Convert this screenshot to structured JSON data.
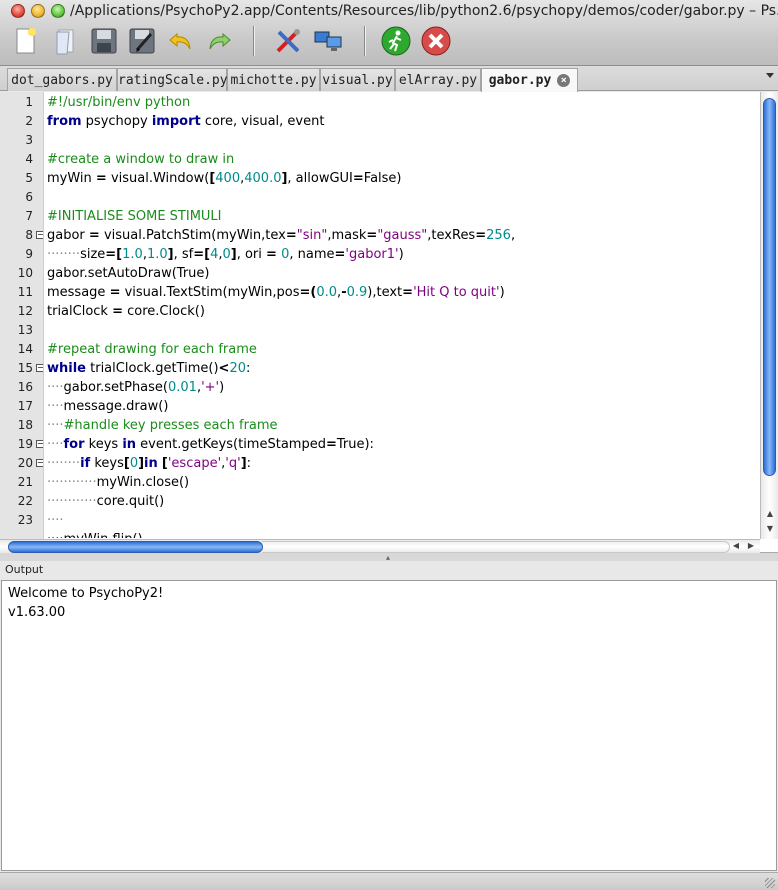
{
  "window": {
    "title": "/Applications/PsychoPy2.app/Contents/Resources/lib/python2.6/psychopy/demos/coder/gabor.py – Ps..."
  },
  "toolbar": {
    "buttons": [
      "new-file-icon",
      "open-file-icon",
      "save-icon",
      "save-as-icon",
      "undo-icon",
      "redo-icon",
      "preferences-icon",
      "monitor-center-icon",
      "run-icon",
      "stop-icon"
    ]
  },
  "tabs": [
    {
      "label": "dot_gabors.py"
    },
    {
      "label": "ratingScale.py"
    },
    {
      "label": "michotte.py"
    },
    {
      "label": "visual.py"
    },
    {
      "label": "elArray.py"
    },
    {
      "label": "gabor.py",
      "active": true,
      "close": "×"
    }
  ],
  "editor": {
    "line_numbers": [
      "1",
      "2",
      "3",
      "4",
      "5",
      "6",
      "7",
      "8",
      "9",
      "10",
      "11",
      "12",
      "13",
      "14",
      "15",
      "16",
      "17",
      "18",
      "19",
      "20",
      "21",
      "22",
      "23"
    ]
  },
  "output": {
    "label": "Output",
    "lines": [
      "Welcome to PsychoPy2!",
      "v1.63.00"
    ]
  },
  "colors": {
    "comment": "#1b8c1b",
    "keyword": "#00008b",
    "string": "#7f007f",
    "number": "#008b8b",
    "scroll_thumb": "#2d6fd8"
  }
}
